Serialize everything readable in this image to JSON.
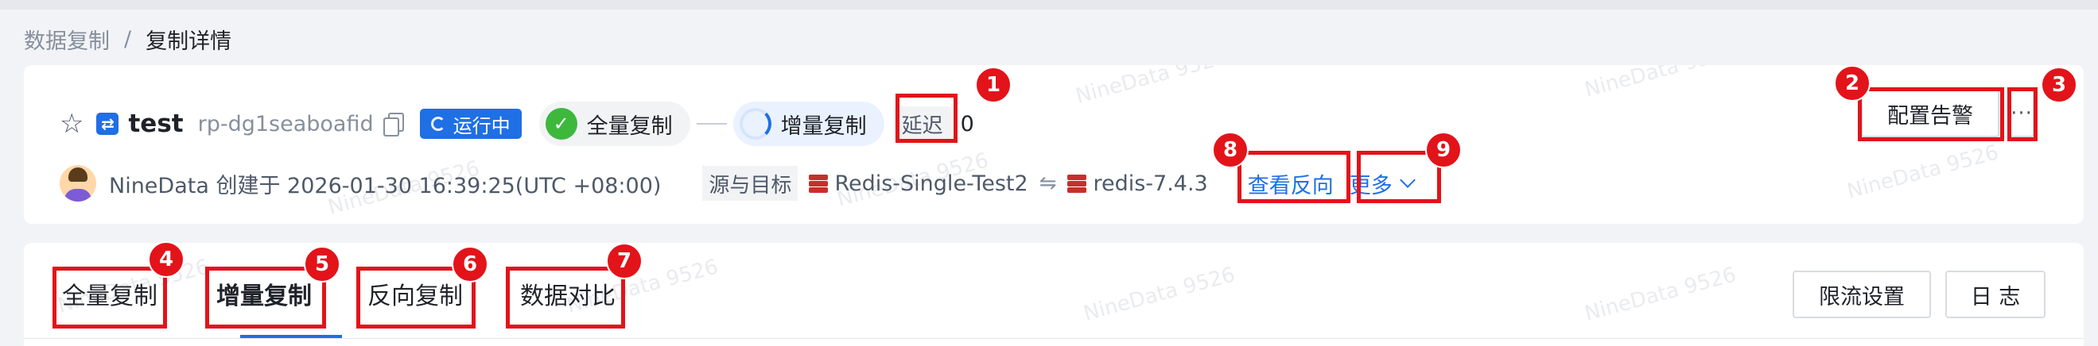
{
  "breadcrumb": {
    "parent": "数据复制",
    "separator": "/",
    "current": "复制详情"
  },
  "task": {
    "name": "test",
    "id": "rp-dg1seaboafid",
    "status": "运行中",
    "stage_full": "全量复制",
    "stage_incremental": "增量复制",
    "delay_label": "延迟",
    "delay_value": "0"
  },
  "meta": {
    "creator_text": "NineData 创建于 2026-01-30 16:39:25(UTC +08:00)",
    "source_target_label": "源与目标",
    "source_name": "Redis-Single-Test2",
    "swap_symbol": "⇋",
    "target_name": "redis-7.4.3",
    "view_reverse_link": "查看反向",
    "more_link": "更多"
  },
  "actions": {
    "config_alert": "配置告警",
    "more": "···",
    "rate_limit": "限流设置",
    "log": "日 志"
  },
  "tabs": [
    {
      "label": "全量复制"
    },
    {
      "label": "增量复制"
    },
    {
      "label": "反向复制"
    },
    {
      "label": "数据对比"
    }
  ],
  "active_tab": "增量复制",
  "annotations": [
    "1",
    "2",
    "3",
    "4",
    "5",
    "6",
    "7",
    "8",
    "9"
  ],
  "watermark": "NineData 9526",
  "colors": {
    "primary": "#1f6fe5",
    "success": "#3db83d",
    "annotation": "#e3131a",
    "redis": "#c6302b"
  },
  "icons": [
    "star-icon",
    "sync-icon",
    "copy-icon",
    "check-circle-icon",
    "progress-ring-icon",
    "redis-icon",
    "swap-icon",
    "chevron-down-icon",
    "more-icon"
  ]
}
